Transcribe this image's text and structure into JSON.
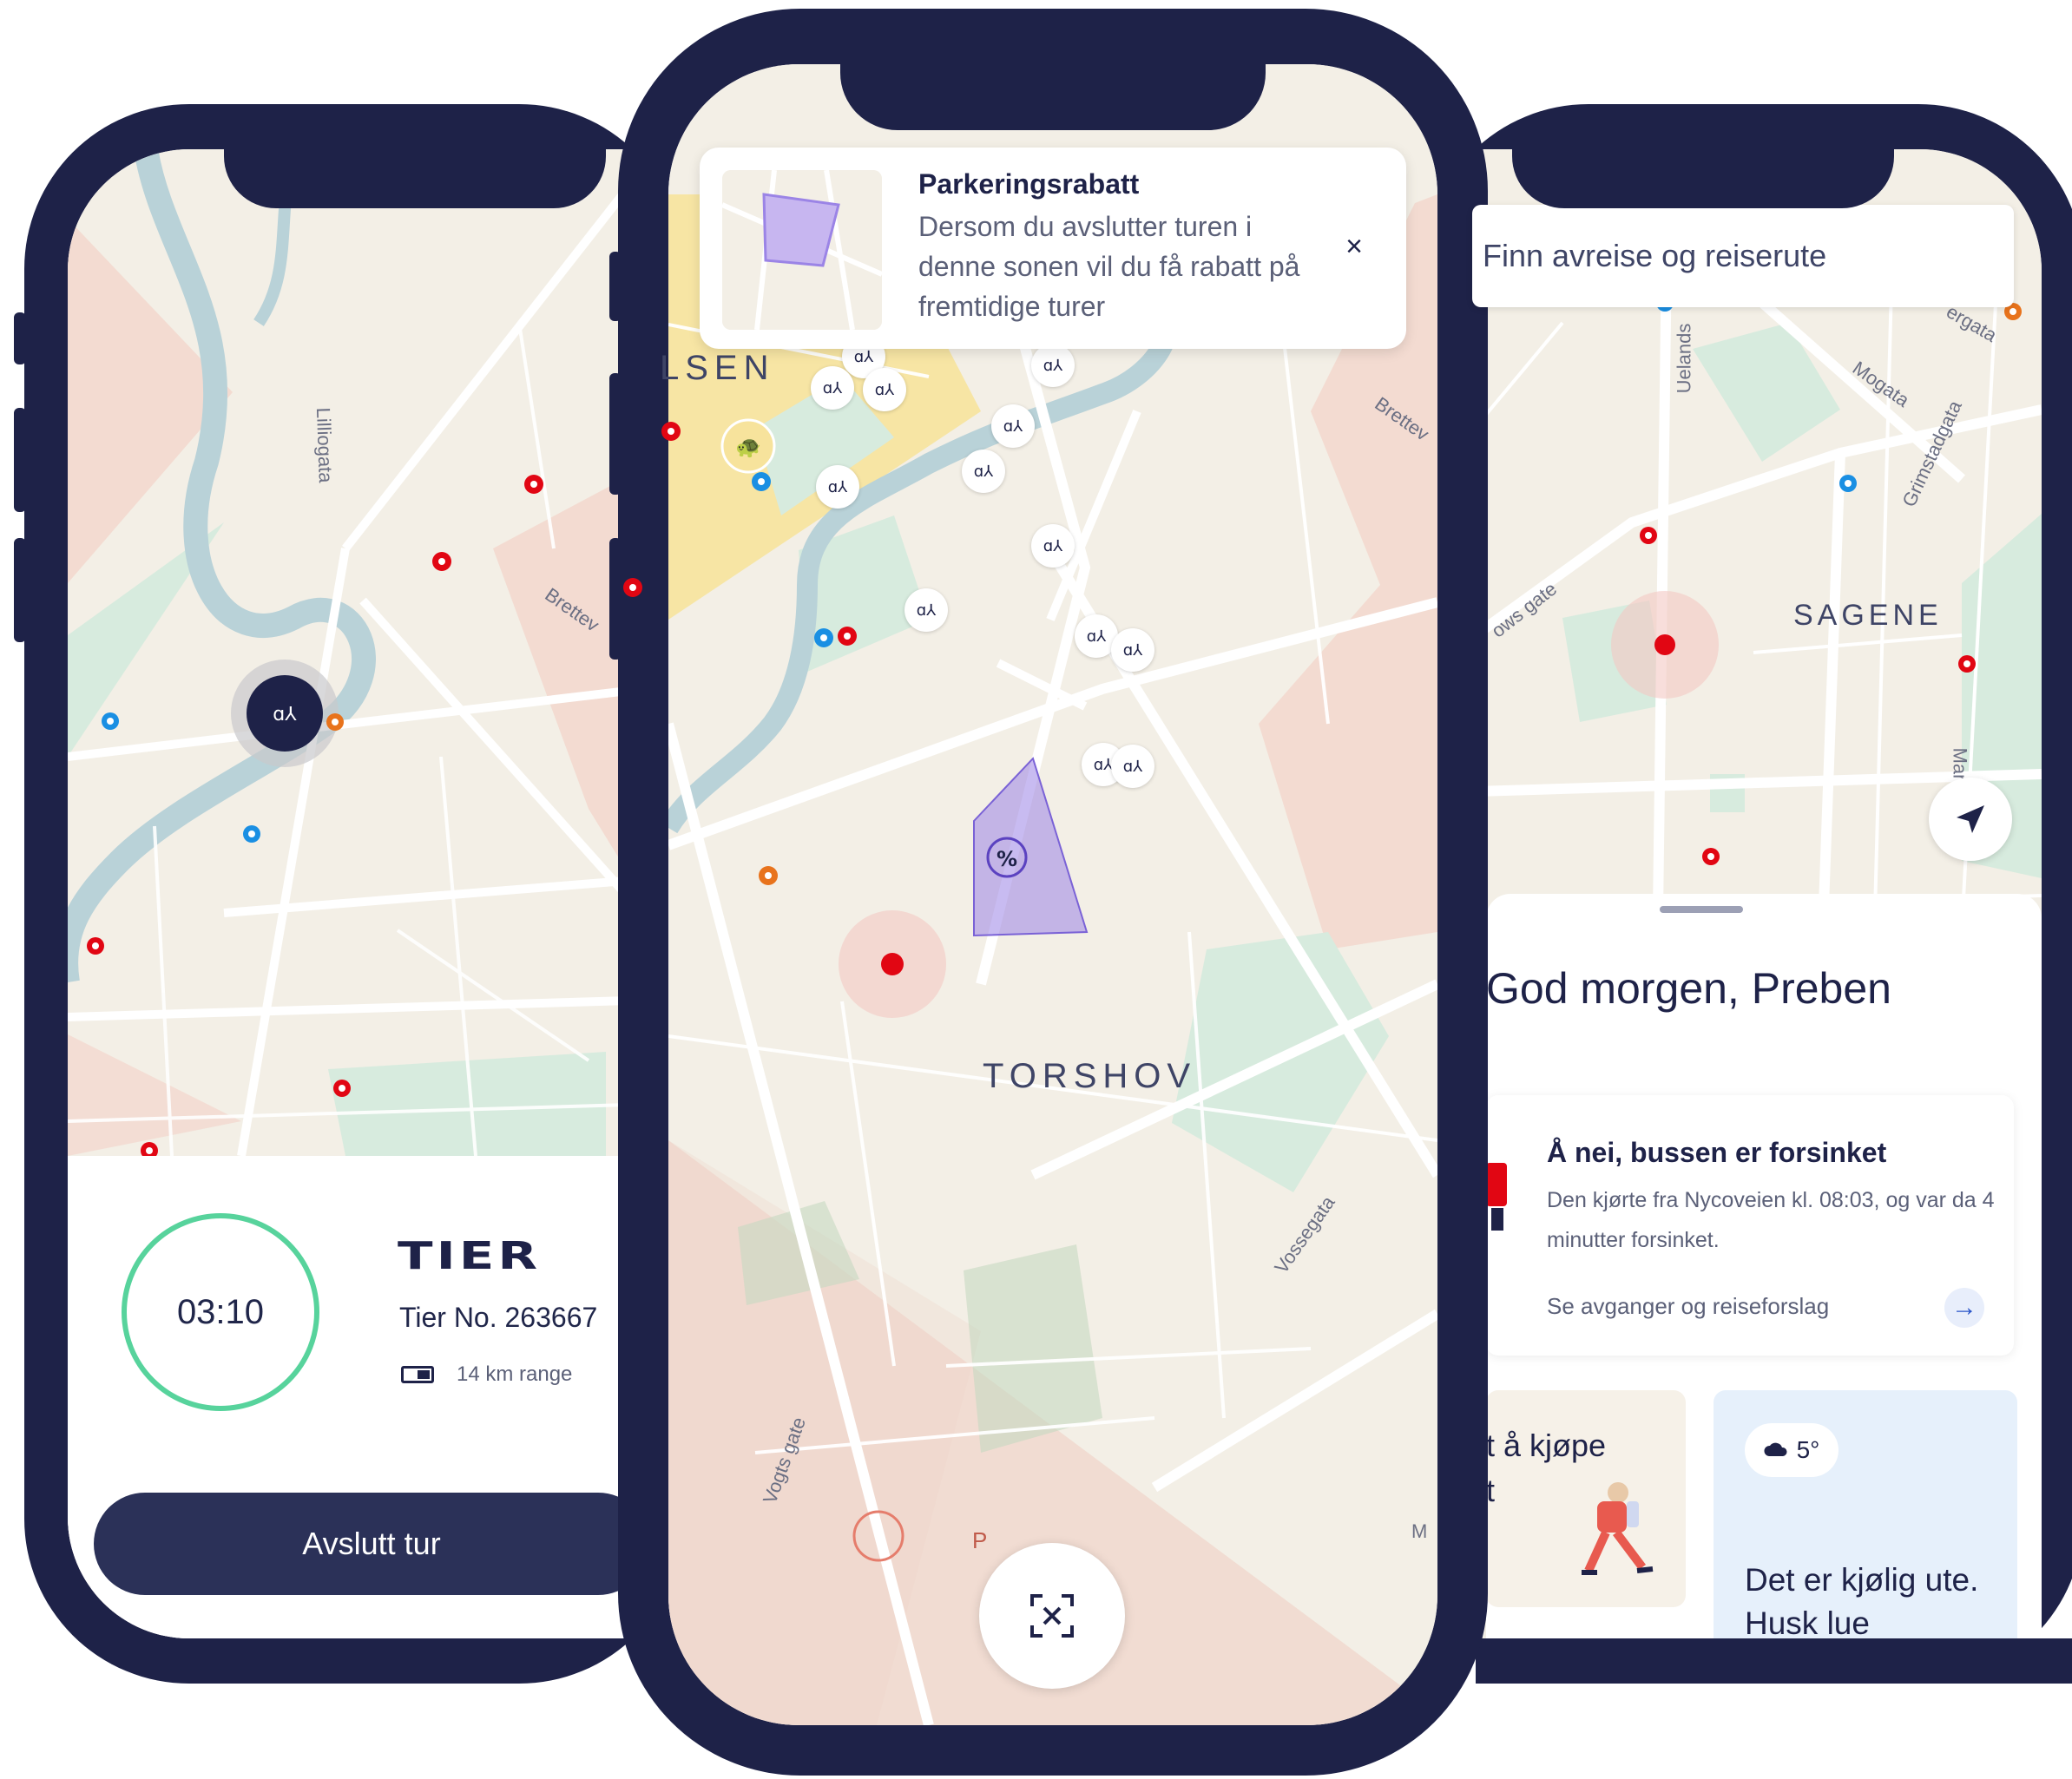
{
  "left_phone": {
    "timer": "03:10",
    "operator_brand": "TIER",
    "vehicle_number": "Tier No. 263667",
    "range": "14 km range",
    "end_ride_label": "Avslutt tur",
    "streets": {
      "s1": "Lilliogata",
      "s2": "Brettev"
    }
  },
  "center_phone": {
    "info_card": {
      "title": "Parkeringsrabatt",
      "body": "Dersom du avslutter turen i denne sonen vil du få rabatt på fremtidige turer",
      "close_icon": "close-icon"
    },
    "district_label": "TORSHOV",
    "zone_label": "LSEN",
    "discount_zone_icon": "percent",
    "parking_label": "P",
    "streets": {
      "s1": "Brettev",
      "s2": "Vossegata",
      "s3": "Vogts gate",
      "s4": "M"
    },
    "colors": {
      "red": "#e10613",
      "blue": "#1a8fe3",
      "orange": "#e8731c",
      "zone_purple": "#9b84e6",
      "zone_yellow": "#f7e39c"
    }
  },
  "right_phone": {
    "search_placeholder": "Finn avreise og reiserute",
    "district_label": "SAGENE",
    "streets": {
      "s1": "Uelands",
      "s2": "Mogata",
      "s3": "Grimstadgata",
      "s4": "ergata",
      "s5": "ows gate",
      "s6": "Marl"
    },
    "greeting": "God morgen, Preben",
    "delay_card": {
      "title": "Å nei, bussen er forsinket",
      "body": "Den kjørte fra Nycoveien kl. 08:03, og var da 4 minutter forsinket.",
      "link": "Se avganger og reiseforslag"
    },
    "ticket_card_text": "t å kjøpe\nt",
    "weather": {
      "temperature": "5°",
      "message": "Det er kjølig ute. Husk lue"
    }
  }
}
